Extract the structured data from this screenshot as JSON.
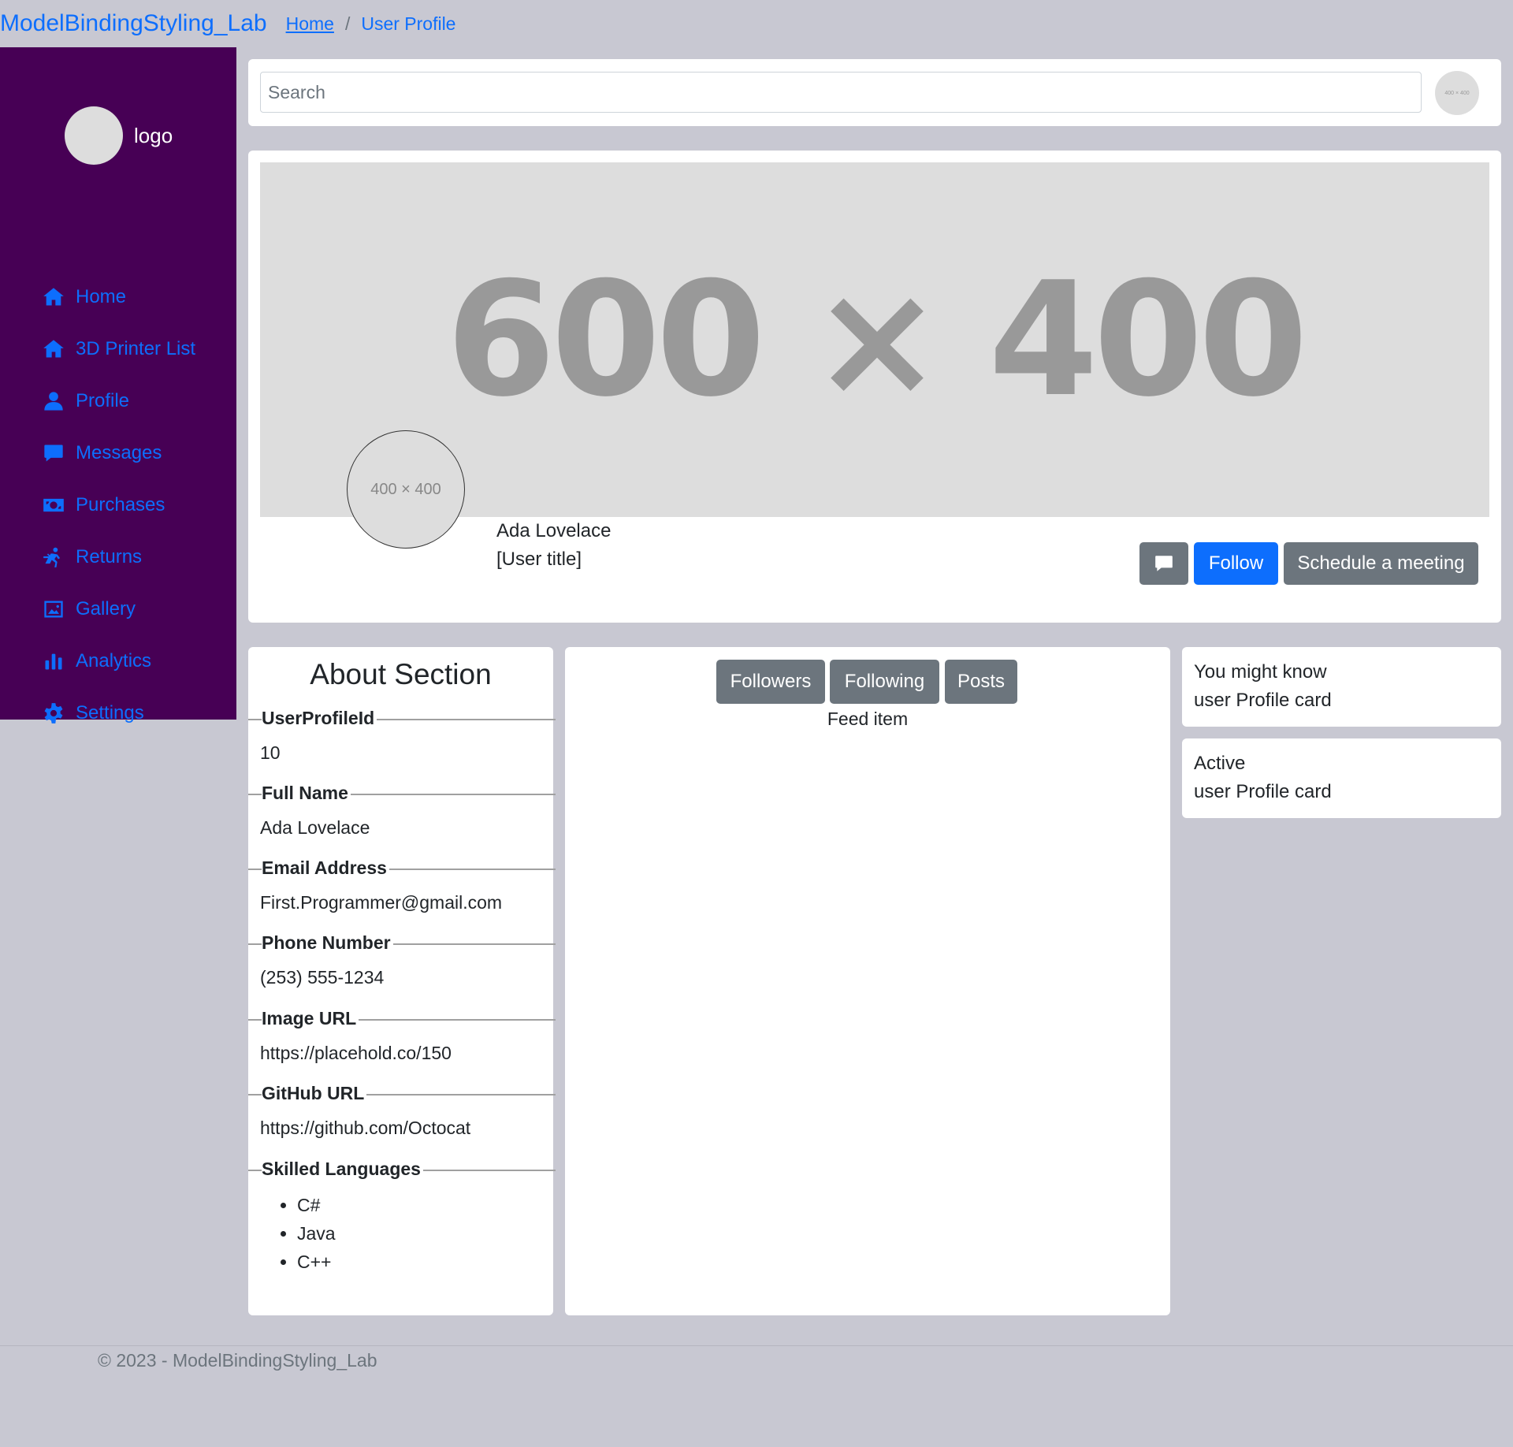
{
  "header": {
    "brand": "ModelBindingStyling_Lab",
    "breadcrumb_home": "Home",
    "breadcrumb_sep": "/",
    "breadcrumb_current": "User Profile"
  },
  "sidebar": {
    "logo_text": "logo",
    "items": [
      {
        "label": "Home",
        "icon": "home-icon"
      },
      {
        "label": "3D Printer List",
        "icon": "home-icon"
      },
      {
        "label": "Profile",
        "icon": "user-icon"
      },
      {
        "label": "Messages",
        "icon": "message-icon"
      },
      {
        "label": "Purchases",
        "icon": "money-icon"
      },
      {
        "label": "Returns",
        "icon": "return-icon"
      },
      {
        "label": "Gallery",
        "icon": "image-icon"
      },
      {
        "label": "Analytics",
        "icon": "chart-icon"
      },
      {
        "label": "Settings",
        "icon": "gear-icon"
      }
    ]
  },
  "search": {
    "placeholder": "Search",
    "avatar_text": "400 × 400"
  },
  "profile": {
    "banner_text": "600 × 400",
    "avatar_text": "400 × 400",
    "name": "Ada Lovelace",
    "title": "[User title]",
    "follow_label": "Follow",
    "schedule_label": "Schedule a meeting"
  },
  "about": {
    "title": "About Section",
    "fields": [
      {
        "label": "UserProfileId",
        "value": "10"
      },
      {
        "label": "Full Name",
        "value": "Ada Lovelace"
      },
      {
        "label": "Email Address",
        "value": "First.Programmer@gmail.com"
      },
      {
        "label": "Phone Number",
        "value": "(253) 555-1234"
      },
      {
        "label": "Image URL",
        "value": "https://placehold.co/150"
      },
      {
        "label": "GitHub URL",
        "value": "https://github.com/Octocat"
      },
      {
        "label": "Skilled Languages",
        "value": ""
      }
    ],
    "languages": [
      "C#",
      "Java",
      "C++"
    ]
  },
  "feed": {
    "tabs": [
      "Followers",
      "Following",
      "Posts"
    ],
    "item": "Feed item"
  },
  "side_cards": [
    {
      "line1": "You might know",
      "line2": "user Profile card"
    },
    {
      "line1": "Active",
      "line2": "user Profile card"
    }
  ],
  "footer": {
    "text": "© 2023 - ModelBindingStyling_Lab"
  },
  "colors": {
    "sidebar_bg": "#470055",
    "page_bg": "#c8c8d2",
    "link": "#0d6efd",
    "secondary_button": "#6c757d",
    "primary_button": "#0d6efd"
  }
}
